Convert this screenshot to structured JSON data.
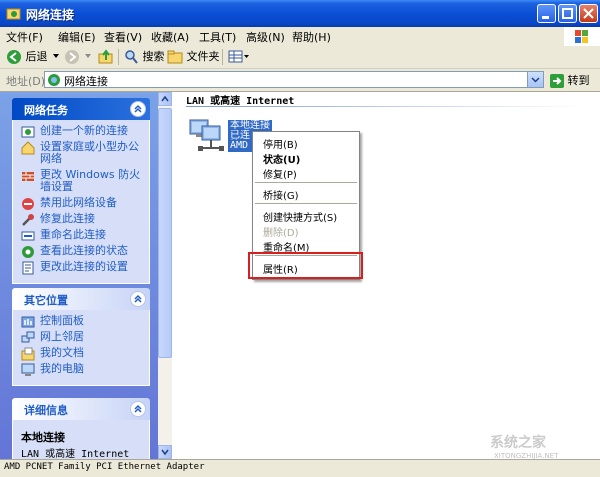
{
  "window": {
    "title": "网络连接"
  },
  "menu": [
    "文件(F)",
    "编辑(E)",
    "查看(V)",
    "收藏(A)",
    "工具(T)",
    "高级(N)",
    "帮助(H)"
  ],
  "toolbar": {
    "back": "后退",
    "search": "搜索",
    "folders": "文件夹"
  },
  "address": {
    "label": "地址(D)",
    "value": "网络连接",
    "go": "转到"
  },
  "network_tasks": {
    "title": "网络任务",
    "items": [
      {
        "icon": "new-connection-icon",
        "label": "创建一个新的连接"
      },
      {
        "icon": "home-network-icon",
        "label": "设置家庭或小型办公网络"
      },
      {
        "icon": "firewall-icon",
        "label": "更改 Windows 防火墙设置"
      },
      {
        "icon": "disable-icon",
        "label": "禁用此网络设备"
      },
      {
        "icon": "repair-icon",
        "label": "修复此连接"
      },
      {
        "icon": "rename-icon",
        "label": "重命名此连接"
      },
      {
        "icon": "status-icon",
        "label": "查看此连接的状态"
      },
      {
        "icon": "settings-icon",
        "label": "更改此连接的设置"
      }
    ]
  },
  "other_places": {
    "title": "其它位置",
    "items": [
      {
        "icon": "control-panel-icon",
        "label": "控制面板"
      },
      {
        "icon": "network-places-icon",
        "label": "网上邻居"
      },
      {
        "icon": "my-documents-icon",
        "label": "我的文档"
      },
      {
        "icon": "my-computer-icon",
        "label": "我的电脑"
      }
    ]
  },
  "details": {
    "title": "详细信息",
    "name": "本地连接",
    "type": "LAN 或高速 Internet"
  },
  "group": {
    "header": "LAN 或高速 Internet"
  },
  "connection": {
    "name": "本地连接",
    "status": "已连接",
    "device": "AMD"
  },
  "context_menu": {
    "disable": "停用(B)",
    "status": "状态(U)",
    "repair": "修复(P)",
    "bridge": "桥接(G)",
    "shortcut": "创建快捷方式(S)",
    "delete": "删除(D)",
    "rename": "重命名(M)",
    "properties": "属性(R)"
  },
  "statusbar": {
    "text": "AMD PCNET Family PCI Ethernet Adapter"
  },
  "watermark": {
    "line1": "系统之家",
    "line2": "XITONGZHIJIA.NET"
  }
}
